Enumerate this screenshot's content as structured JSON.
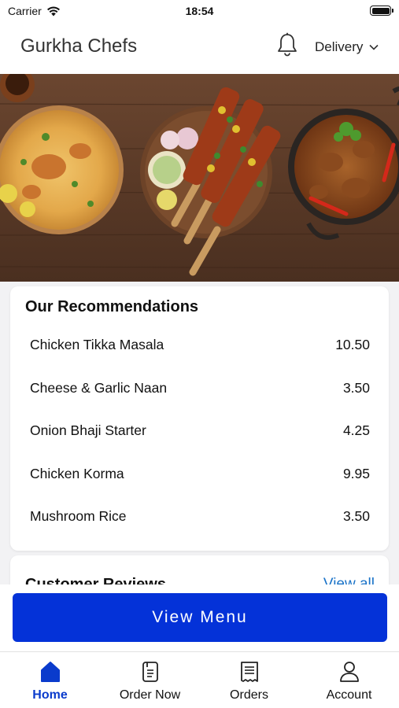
{
  "status_bar": {
    "carrier": "Carrier",
    "time": "18:54",
    "battery_level": 1.0
  },
  "header": {
    "title": "Gurkha Chefs",
    "delivery_label": "Delivery"
  },
  "recommendations": {
    "title": "Our Recommendations",
    "items": [
      {
        "name": "Chicken Tikka Masala",
        "price": "10.50"
      },
      {
        "name": "Cheese & Garlic Naan",
        "price": "3.50"
      },
      {
        "name": "Onion Bhaji Starter",
        "price": "4.25"
      },
      {
        "name": "Chicken Korma",
        "price": "9.95"
      },
      {
        "name": "Mushroom Rice",
        "price": "3.50"
      }
    ]
  },
  "reviews": {
    "title": "Customer Reviews",
    "view_all": "View all"
  },
  "cta": {
    "label": "View Menu"
  },
  "tabs": [
    {
      "label": "Home",
      "icon": "home-icon",
      "active": true
    },
    {
      "label": "Order Now",
      "icon": "menu-book-icon",
      "active": false
    },
    {
      "label": "Orders",
      "icon": "receipt-icon",
      "active": false
    },
    {
      "label": "Account",
      "icon": "person-icon",
      "active": false
    }
  ],
  "colors": {
    "accent": "#0432d8",
    "active_tab": "#0a3bcc",
    "link": "#1a73c8"
  }
}
